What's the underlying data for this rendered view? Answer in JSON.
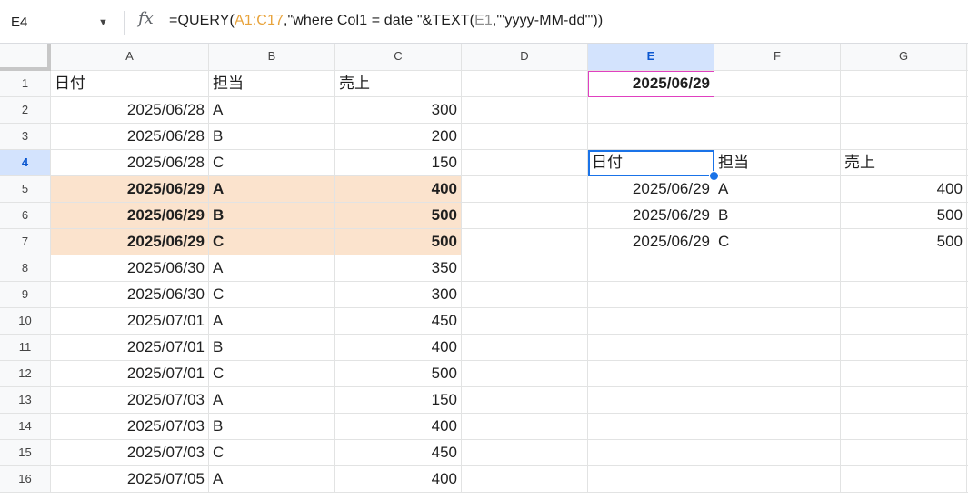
{
  "namebox": {
    "ref": "E4",
    "caret": "▼"
  },
  "formula_bar": {
    "fx": "fx",
    "tokens": [
      {
        "t": "=QUERY(",
        "c": "tok-plain"
      },
      {
        "t": "A1:C17",
        "c": "tok-range1"
      },
      {
        "t": ",\"where Col1 = date \"&TEXT(",
        "c": "tok-str"
      },
      {
        "t": "E1",
        "c": "tok-range2"
      },
      {
        "t": ",\"'yyyy-MM-dd'\"))",
        "c": "tok-str"
      }
    ]
  },
  "columns": [
    "A",
    "B",
    "C",
    "D",
    "E",
    "F",
    "G"
  ],
  "rows": [
    "1",
    "2",
    "3",
    "4",
    "5",
    "6",
    "7",
    "8",
    "9",
    "10",
    "11",
    "12",
    "13",
    "14",
    "15",
    "16"
  ],
  "selected": {
    "col": "E",
    "row": "4"
  },
  "cells": {
    "A1": "日付",
    "B1": "担当",
    "C1": "売上",
    "E1": "2025/06/29",
    "A2": "2025/06/28",
    "B2": "A",
    "C2": "300",
    "A3": "2025/06/28",
    "B3": "B",
    "C3": "200",
    "A4": "2025/06/28",
    "B4": "C",
    "C4": "150",
    "E4": "日付",
    "F4": "担当",
    "G4": "売上",
    "A5": "2025/06/29",
    "B5": "A",
    "C5": "400",
    "E5": "2025/06/29",
    "F5": "A",
    "G5": "400",
    "A6": "2025/06/29",
    "B6": "B",
    "C6": "500",
    "E6": "2025/06/29",
    "F6": "B",
    "G6": "500",
    "A7": "2025/06/29",
    "B7": "C",
    "C7": "500",
    "E7": "2025/06/29",
    "F7": "C",
    "G7": "500",
    "A8": "2025/06/30",
    "B8": "A",
    "C8": "350",
    "A9": "2025/06/30",
    "B9": "C",
    "C9": "300",
    "A10": "2025/07/01",
    "B10": "A",
    "C10": "450",
    "A11": "2025/07/01",
    "B11": "B",
    "C11": "400",
    "A12": "2025/07/01",
    "B12": "C",
    "C12": "500",
    "A13": "2025/07/03",
    "B13": "A",
    "C13": "150",
    "A14": "2025/07/03",
    "B14": "B",
    "C14": "400",
    "A15": "2025/07/03",
    "B15": "C",
    "C15": "450",
    "A16": "2025/07/05",
    "B16": "A",
    "C16": "400"
  },
  "formats": {
    "right_aligned_cells": [
      "A2",
      "A3",
      "A4",
      "A5",
      "A6",
      "A7",
      "A8",
      "A9",
      "A10",
      "A11",
      "A12",
      "A13",
      "A14",
      "A15",
      "A16",
      "C2",
      "C3",
      "C4",
      "C5",
      "C6",
      "C7",
      "C8",
      "C9",
      "C10",
      "C11",
      "C12",
      "C13",
      "C14",
      "C15",
      "C16",
      "E1",
      "E5",
      "E6",
      "E7",
      "G5",
      "G6",
      "G7"
    ],
    "bold_cells": [
      "A5",
      "B5",
      "C5",
      "A6",
      "B6",
      "C6",
      "A7",
      "B7",
      "C7",
      "E1"
    ],
    "highlight_cells": [
      "A5",
      "B5",
      "C5",
      "A6",
      "B6",
      "C6",
      "A7",
      "B7",
      "C7"
    ],
    "highlight_color": "#fbe3cd",
    "selection_color": "#1a73e8",
    "e1_border_color": "#e040c0"
  }
}
